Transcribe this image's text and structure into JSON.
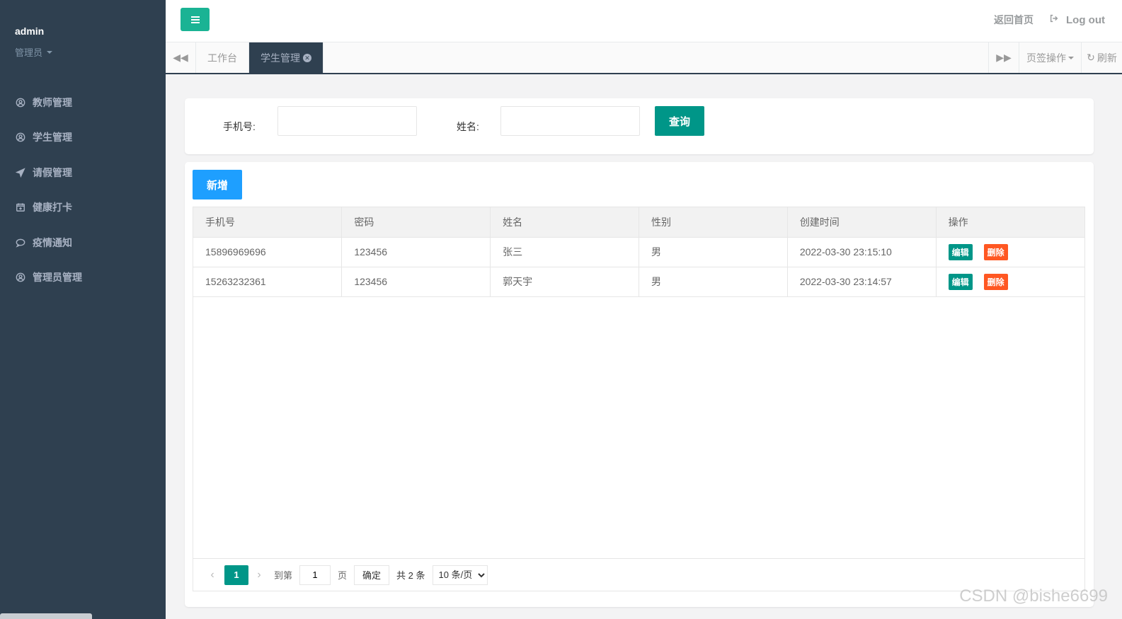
{
  "sidebar": {
    "user_name": "admin",
    "user_role": "管理员",
    "items": [
      {
        "label": "教师管理",
        "icon": "user-circle-icon"
      },
      {
        "label": "学生管理",
        "icon": "user-circle-outline-icon"
      },
      {
        "label": "请假管理",
        "icon": "paper-plane-icon"
      },
      {
        "label": "健康打卡",
        "icon": "calendar-plus-icon"
      },
      {
        "label": "疫情通知",
        "icon": "comment-dots-icon"
      },
      {
        "label": "管理员管理",
        "icon": "user-circle-icon"
      }
    ]
  },
  "topbar": {
    "home_link": "返回首页",
    "logout_label": "Log out"
  },
  "tabbar": {
    "tabs": [
      {
        "label": "工作台"
      },
      {
        "label": "学生管理",
        "active": true
      }
    ],
    "tab_ops_label": "页签操作",
    "refresh_label": "刷新"
  },
  "search": {
    "phone_label": "手机号:",
    "phone_value": "",
    "name_label": "姓名:",
    "name_value": "",
    "query_button": "查询"
  },
  "table": {
    "add_button": "新增",
    "columns": [
      "手机号",
      "密码",
      "姓名",
      "性别",
      "创建时间",
      "操作"
    ],
    "rows": [
      {
        "phone": "15896969696",
        "password": "123456",
        "name": "张三",
        "gender": "男",
        "created": "2022-03-30 23:15:10"
      },
      {
        "phone": "15263232361",
        "password": "123456",
        "name": "郭天宇",
        "gender": "男",
        "created": "2022-03-30 23:14:57"
      }
    ],
    "edit_label": "编辑",
    "delete_label": "删除"
  },
  "pager": {
    "current_page": "1",
    "goto_label": "到第",
    "goto_value": "1",
    "page_unit": "页",
    "confirm_label": "确定",
    "total_label": "共 2 条",
    "page_size_label": "10 条/页"
  },
  "watermark": "CSDN @bishe6699",
  "colors": {
    "sidebar_bg": "#2f4050",
    "primary_green": "#1ab394",
    "teal": "#009688",
    "blue": "#1e9fff",
    "danger": "#ff5722"
  }
}
